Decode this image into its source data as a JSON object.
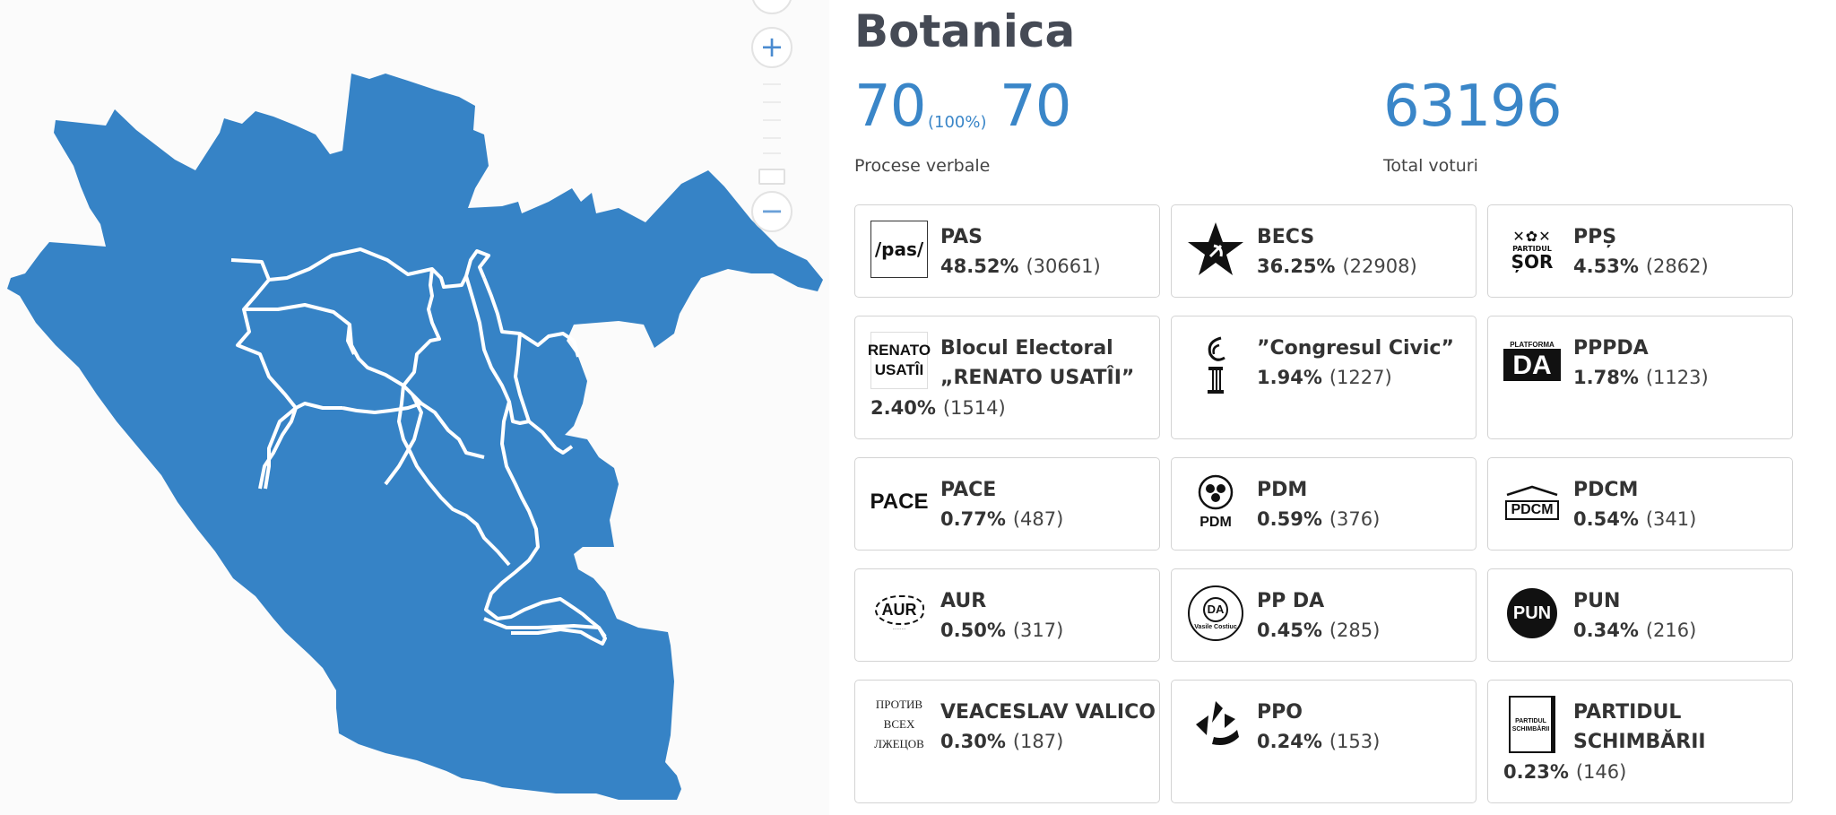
{
  "map": {
    "colors": {
      "fill": "#3683c6",
      "border": "#ffffff",
      "background": "#fbfbfb"
    },
    "zoom_in_symbol": "+",
    "zoom_out_symbol": "−"
  },
  "district": {
    "name": "Botanica"
  },
  "stats": {
    "protocols_processed": "70",
    "protocols_percent": "(100%)",
    "protocols_total": "70",
    "protocols_label": "Procese verbale",
    "total_votes": "63196",
    "total_votes_label": "Total voturi"
  },
  "accent_color": "#3a86c8",
  "parties": [
    {
      "name": "PAS",
      "percent": "48.52%",
      "votes": "(30661)",
      "logo": "pas-logo",
      "logo_text": "/pas/"
    },
    {
      "name": "BECS",
      "percent": "36.25%",
      "votes": "(22908)",
      "logo": "star-hammer-sickle-icon"
    },
    {
      "name": "PPȘ",
      "percent": "4.53%",
      "votes": "(2862)",
      "logo": "partidul-sor-logo",
      "logo_text": "PARTIDUL",
      "logo_text2": "ȘOR"
    },
    {
      "name": "Blocul Electoral „RENATO USATÎI”",
      "percent": "2.40%",
      "votes": "(1514)",
      "logo": "renato-usatii-logo",
      "logo_text": "RENATO",
      "logo_text2": "USATÎI"
    },
    {
      "name": "”Congresul Civic”",
      "percent": "1.94%",
      "votes": "(1227)",
      "logo": "congresul-civic-logo"
    },
    {
      "name": "PPPDA",
      "percent": "1.78%",
      "votes": "(1123)",
      "logo": "platforma-da-logo",
      "logo_text": "PLATFORMA",
      "logo_text2": "DA"
    },
    {
      "name": "PACE",
      "percent": "0.77%",
      "votes": "(487)",
      "logo": "pace-logo",
      "logo_text": "PACE"
    },
    {
      "name": "PDM",
      "percent": "0.59%",
      "votes": "(376)",
      "logo": "pdm-rose-logo",
      "logo_text": "PDM"
    },
    {
      "name": "PDCM",
      "percent": "0.54%",
      "votes": "(341)",
      "logo": "pdcm-logo",
      "logo_text": "PDCM"
    },
    {
      "name": "AUR",
      "percent": "0.50%",
      "votes": "(317)",
      "logo": "aur-logo",
      "logo_text": "AUR"
    },
    {
      "name": "PP DA",
      "percent": "0.45%",
      "votes": "(285)",
      "logo": "pp-da-seal-logo",
      "logo_text": "DA",
      "logo_text2": "Vasile Costiuc"
    },
    {
      "name": "PUN",
      "percent": "0.34%",
      "votes": "(216)",
      "logo": "pun-logo",
      "logo_text": "PUN"
    },
    {
      "name": "VEACESLAV VALICO",
      "percent": "0.30%",
      "votes": "(187)",
      "logo": "protiv-vsekh-logo",
      "logo_text": "ПРОТИВ",
      "logo_text2": "ВСЕХ",
      "logo_text3": "ЛЖЕЦОВ"
    },
    {
      "name": "PPO",
      "percent": "0.24%",
      "votes": "(153)",
      "logo": "ppo-logo"
    },
    {
      "name": "PARTIDUL SCHIMBĂRII",
      "percent": "0.23%",
      "votes": "(146)",
      "logo": "partidul-schimbarii-logo",
      "logo_text": "PARTIDUL",
      "logo_text2": "SCHIMBĂRII"
    }
  ]
}
